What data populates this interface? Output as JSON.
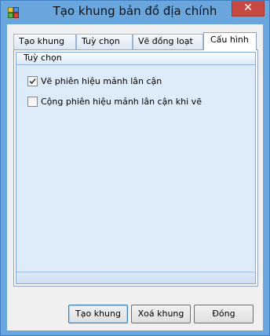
{
  "window": {
    "title": "Tạo khung bản đồ địa chính",
    "close_glyph": "✕",
    "app_icon": "map-icon"
  },
  "tabs": [
    {
      "label": "Tạo khung",
      "active": false
    },
    {
      "label": "Tuỳ chọn",
      "active": false
    },
    {
      "label": "Vẽ đồng loạt",
      "active": false
    },
    {
      "label": "Cấu hình",
      "active": true
    }
  ],
  "group": {
    "header": "Tuỳ chọn",
    "options": [
      {
        "label": "Vẽ phiên hiệu mảnh lân cận",
        "checked": true
      },
      {
        "label": "Cộng phiên hiệu mảnh lân cận khi vẽ",
        "checked": false
      }
    ]
  },
  "buttons": {
    "create": "Tạo khung",
    "delete": "Xoá khung",
    "close": "Đóng"
  },
  "colors": {
    "frame": "#68a6dd",
    "close_button": "#c74a42",
    "group_background": "#deebf8"
  }
}
